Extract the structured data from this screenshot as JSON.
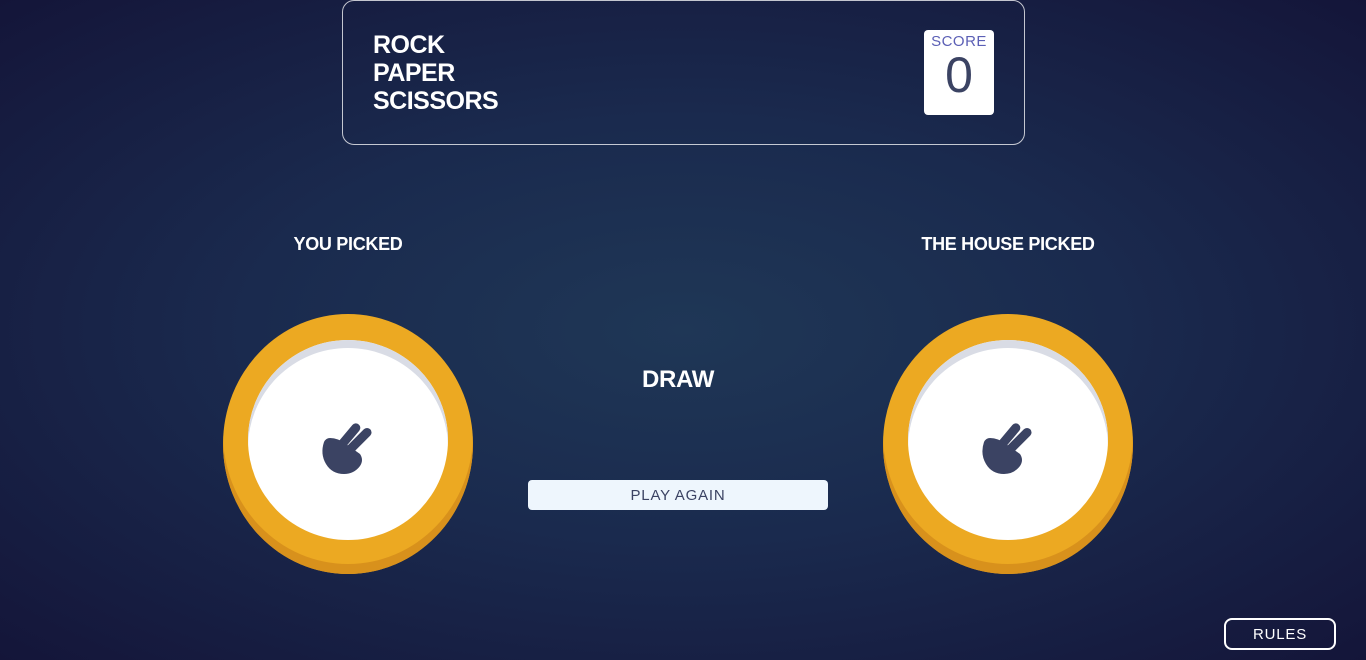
{
  "header": {
    "title_lines": [
      "ROCK",
      "PAPER",
      "SCISSORS"
    ],
    "score_label": "SCORE",
    "score_value": "0"
  },
  "player": {
    "label": "YOU PICKED",
    "pick_icon": "scissors-hand-icon",
    "pick_color": "#eca922"
  },
  "house": {
    "label": "THE HOUSE PICKED",
    "pick_icon": "scissors-hand-icon",
    "pick_color": "#eca922"
  },
  "result": {
    "text": "DRAW",
    "play_again_label": "PLAY AGAIN"
  },
  "footer": {
    "rules_label": "RULES"
  },
  "colors": {
    "background_center": "#1f3756",
    "background_edge": "#141539",
    "token_gold": "#eca922",
    "icon_dark": "#3b4363",
    "score_label": "#5b5fb5"
  }
}
